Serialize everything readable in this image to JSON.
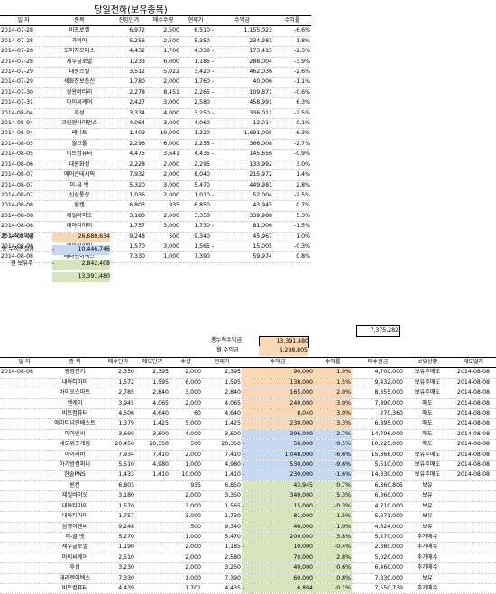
{
  "title": "당일천하(보유종목)",
  "top_table": {
    "headers": [
      "일 자",
      "종목",
      "진입단가",
      "매수수량",
      "현재가",
      "수익금",
      "수익률"
    ],
    "rows": [
      [
        "2014-07-28",
        "비프로셀",
        "6,972",
        "2,500",
        "6,510",
        "-",
        "1,155,023",
        "-6.6%"
      ],
      [
        "2014-07-28",
        "가비아",
        "5,256",
        "2,500",
        "5,350",
        "",
        "234,981",
        "1.8%"
      ],
      [
        "2014-07-28",
        "도이치모터스",
        "4,432",
        "1,700",
        "4,330",
        "-",
        "173,415",
        "-2.3%"
      ],
      [
        "2014-07-28",
        "세우글로벌",
        "1,233",
        "6,000",
        "1,185",
        "-",
        "288,004",
        "-3.9%"
      ],
      [
        "2014-07-29",
        "대동스틸",
        "3,512",
        "5,022",
        "3,420",
        "-",
        "462,036",
        "-2.6%"
      ],
      [
        "2014-07-29",
        "세화정보통신",
        "1,780",
        "2,000",
        "1,760",
        "-",
        "40,006",
        "-1.1%"
      ],
      [
        "2014-07-30",
        "쌍용머티리",
        "2,278",
        "8,451",
        "2,265",
        "-",
        "109,871",
        "-0.6%"
      ],
      [
        "2014-07-31",
        "아이씨케어",
        "2,427",
        "3,000",
        "2,580",
        "",
        "458,991",
        "6.3%"
      ],
      [
        "2014-08-04",
        "후성",
        "3,334",
        "4,000",
        "3,250",
        "-",
        "336,011",
        "-2.5%"
      ],
      [
        "2014-08-04",
        "크린앤사이언스",
        "4,064",
        "3,000",
        "4,060",
        "-",
        "12,014",
        "-0.1%"
      ],
      [
        "2014-08-04",
        "쎄니트",
        "1,409",
        "19,000",
        "1,320",
        "-",
        "1,691,005",
        "-6.3%"
      ],
      [
        "2014-08-05",
        "월크툴",
        "2,296",
        "6,000",
        "2,235",
        "-",
        "366,008",
        "-2.7%"
      ],
      [
        "2014-08-05",
        "비트컴퓨터",
        "4,475",
        "3,641",
        "4,435",
        "-",
        "145,656",
        "-0.9%"
      ],
      [
        "2014-08-06",
        "대원화성",
        "2,228",
        "2,000",
        "2,295",
        "",
        "133,992",
        "3.0%"
      ],
      [
        "2014-08-07",
        "에어슨테시픽",
        "7,932",
        "2,000",
        "8,040",
        "",
        "215,972",
        "1.4%"
      ],
      [
        "2014-08-07",
        "이-글 벳",
        "5,320",
        "3,000",
        "5,470",
        "",
        "449,981",
        "2.8%"
      ],
      [
        "2014-08-07",
        "신성통상",
        "1,036",
        "2,000",
        "1,010",
        "-",
        "52,004",
        "-2.5%"
      ],
      [
        "2014-08-08",
        "원캔",
        "6,803",
        "935",
        "6,850",
        "",
        "43,945",
        "0.7%"
      ],
      [
        "2014-08-08",
        "제일바이오",
        "3,180",
        "2,000",
        "3,350",
        "",
        "339,988",
        "5.3%"
      ],
      [
        "2014-08-08",
        "대아티아이",
        "1,757",
        "3,000",
        "1,730",
        "-",
        "81,006",
        "-1.5%"
      ],
      [
        "2014-08-08",
        "삼영이엔씨",
        "9,248",
        "500",
        "9,340",
        "",
        "45,967",
        "1.0%"
      ],
      [
        "2014-08-08",
        "대아티아이",
        "1,570",
        "3,000",
        "1,565",
        "-",
        "15,005",
        "-0.3%"
      ],
      [
        "2014-08-08",
        "테라젠이텍스",
        "7,330",
        "1,000",
        "7,390",
        "",
        "59,974",
        "0.8%"
      ]
    ]
  },
  "summary": {
    "profit_label": "총 누적수익금",
    "profit_value": "26,680,634",
    "loss_label": "총 누적손실금",
    "loss_dash": "-",
    "loss_value": "10,446,746",
    "hold_label": "현 보유주",
    "hold_dash": "-",
    "hold_value": "2,842,408",
    "total_value": "13,391,480",
    "boxed_value": "7,375,282",
    "total_profit_label": "총누적수익금",
    "total_profit_value": "13,391,480",
    "monthly_label": "월 수익금",
    "monthly_value": "6,298,805"
  },
  "bottom_table": {
    "headers": [
      "일 자",
      "종 목",
      "매수단가",
      "매도단가",
      "수량",
      "현재가",
      "수익금",
      "수익률",
      "매수원금",
      "보유상황",
      "매도일자"
    ],
    "rows": [
      {
        "d": "2014-08-08",
        "n": "광명전기",
        "b": "2,350",
        "s": "2,395",
        "q": "2,000",
        "p": "2,395",
        "pl": "90,000",
        "r": "1.9%",
        "a": "4,700,000",
        "st": "보유주매도",
        "sd": "2014-08-08",
        "c": "peach"
      },
      {
        "d": "",
        "n": "대아티아이",
        "b": "1,572",
        "s": "1,595",
        "q": "6,000",
        "p": "1,595",
        "pl": "138,000",
        "r": "1.5%",
        "a": "9,432,000",
        "st": "보유주매도",
        "sd": "2014-08-08",
        "c": "peach"
      },
      {
        "d": "",
        "n": "바이오스마트",
        "b": "2,785",
        "s": "2,840",
        "q": "3,000",
        "p": "2,840",
        "pl": "165,000",
        "r": "2.0%",
        "a": "8,355,000",
        "st": "보유주매도",
        "sd": "2014-08-08",
        "c": "peach"
      },
      {
        "d": "",
        "n": "엔케이",
        "b": "3,945",
        "s": "4,065",
        "q": "2,000",
        "p": "4,065",
        "pl": "240,000",
        "r": "3.0%",
        "a": "7,890,000",
        "st": "매도",
        "sd": "2014-08-08",
        "c": "peach"
      },
      {
        "d": "",
        "n": "비트컴퓨터",
        "b": "4,506",
        "s": "4,640",
        "q": "60",
        "p": "4,640",
        "pl": "8,040",
        "r": "3.0%",
        "a": "270,360",
        "st": "매도",
        "sd": "2014-08-08",
        "c": "peach"
      },
      {
        "d": "",
        "n": "에이티넘인베스트",
        "b": "1,379",
        "s": "1,425",
        "q": "5,000",
        "p": "1,425",
        "pl": "230,000",
        "r": "3.3%",
        "a": "6,895,000",
        "st": "매도",
        "sd": "2014-08-08",
        "c": "peach"
      },
      {
        "d": "",
        "n": "아이엔씨",
        "b": "3,699",
        "s": "3,600",
        "q": "4,000",
        "p": "3,600",
        "pl": "396,000",
        "r": "-2.7%",
        "a": "14,796,000",
        "st": "매도",
        "sd": "2014-08-08",
        "c": "blue",
        "neg": true
      },
      {
        "d": "",
        "n": "네오위즈게임",
        "b": "20,450",
        "s": "20,350",
        "q": "500",
        "p": "20,350",
        "pl": "50,000",
        "r": "-0.5%",
        "a": "10,225,000",
        "st": "매도",
        "sd": "2014-08-08",
        "c": "blue",
        "neg": true
      },
      {
        "d": "",
        "n": "아이리버",
        "b": "7,934",
        "s": "7,410",
        "q": "2,000",
        "p": "7,410",
        "pl": "1,048,000",
        "r": "-6.6%",
        "a": "15,868,000",
        "st": "보유주매도",
        "sd": "2014-08-08",
        "c": "blue",
        "neg": true
      },
      {
        "d": "",
        "n": "아가방컴퍼니",
        "b": "5,510",
        "s": "4,980",
        "q": "1,000",
        "p": "4,980",
        "pl": "530,000",
        "r": "-9.6%",
        "a": "5,510,000",
        "st": "보유주매도",
        "sd": "2014-08-08",
        "c": "blue",
        "neg": true
      },
      {
        "d": "",
        "n": "한솔PNS",
        "b": "1,433",
        "s": "1,410",
        "q": "10,000",
        "p": "1,410",
        "pl": "230,000",
        "r": "-1.6%",
        "a": "14,330,000",
        "st": "보유주매도",
        "sd": "2014-08-08",
        "c": "blue",
        "neg": true
      },
      {
        "d": "",
        "n": "원캔",
        "b": "6,803",
        "s": "",
        "q": "935",
        "p": "6,850",
        "pl": "43,945",
        "r": "0.7%",
        "a": "6,360,805",
        "st": "보유",
        "sd": "",
        "c": "green"
      },
      {
        "d": "",
        "n": "제일바이오",
        "b": "3,180",
        "s": "",
        "q": "2,000",
        "p": "3,350",
        "pl": "340,000",
        "r": "5.3%",
        "a": "6,360,000",
        "st": "보유",
        "sd": "",
        "c": "green"
      },
      {
        "d": "",
        "n": "대아티아이",
        "b": "1,570",
        "s": "",
        "q": "3,000",
        "p": "1,565",
        "pl": "15,000",
        "r": "-0.3%",
        "a": "4,710,000",
        "st": "보유",
        "sd": "",
        "c": "green",
        "neg": true
      },
      {
        "d": "",
        "n": "대아티아이",
        "b": "1,757",
        "s": "",
        "q": "3,000",
        "p": "1,730",
        "pl": "81,000",
        "r": "-1.5%",
        "a": "5,271,000",
        "st": "보유",
        "sd": "",
        "c": "green",
        "neg": true
      },
      {
        "d": "",
        "n": "삼영이엔씨",
        "b": "9,248",
        "s": "",
        "q": "500",
        "p": "9,340",
        "pl": "46,000",
        "r": "1.0%",
        "a": "4,624,000",
        "st": "보유",
        "sd": "",
        "c": "green"
      },
      {
        "d": "",
        "n": "이-글 벳",
        "b": "5,270",
        "s": "",
        "q": "1,000",
        "p": "5,470",
        "pl": "200,000",
        "r": "3.8%",
        "a": "5,270,000",
        "st": "추가매수",
        "sd": "",
        "c": "green"
      },
      {
        "d": "",
        "n": "세우글로벌",
        "b": "1,190",
        "s": "",
        "q": "2,000",
        "p": "1,185",
        "pl": "10,000",
        "r": "-0.4%",
        "a": "2,380,000",
        "st": "추가매수",
        "sd": "",
        "c": "green",
        "neg": true
      },
      {
        "d": "",
        "n": "아이씨케어",
        "b": "2,510",
        "s": "",
        "q": "2,000",
        "p": "2,580",
        "pl": "70,000",
        "r": "2.8%",
        "a": "5,020,000",
        "st": "추가매수",
        "sd": "",
        "c": "green"
      },
      {
        "d": "",
        "n": "후성",
        "b": "3,230",
        "s": "",
        "q": "2,000",
        "p": "3,250",
        "pl": "40,000",
        "r": "0.6%",
        "a": "6,460,000",
        "st": "추가매수",
        "sd": "",
        "c": "green"
      },
      {
        "d": "",
        "n": "테라젠이텍스",
        "b": "7,330",
        "s": "",
        "q": "1,000",
        "p": "7,390",
        "pl": "60,000",
        "r": "0.8%",
        "a": "7,330,000",
        "st": "보유",
        "sd": "",
        "c": "green"
      },
      {
        "d": "",
        "n": "비트컴퓨터",
        "b": "4,439",
        "s": "",
        "q": "1,701",
        "p": "4,435",
        "pl": "6,804",
        "r": "-0.1%",
        "a": "7,550,739",
        "st": "추가매수",
        "sd": "",
        "c": "green",
        "neg": true
      }
    ]
  }
}
